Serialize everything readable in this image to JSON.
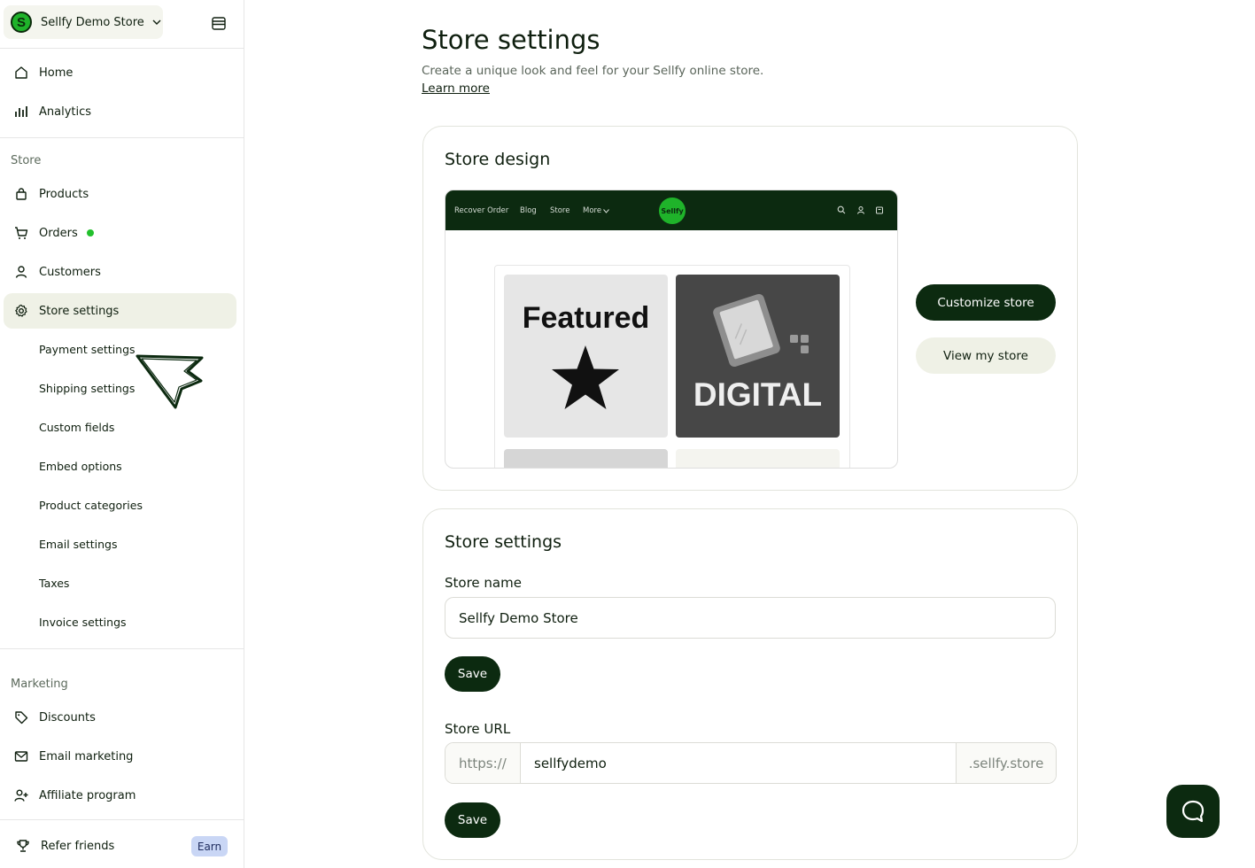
{
  "sidebar": {
    "store_switch": {
      "initial": "S",
      "name": "Sellfy Demo Store"
    },
    "top_nav": [
      {
        "label": "Home",
        "icon": "home-icon"
      },
      {
        "label": "Analytics",
        "icon": "bar-chart-icon"
      }
    ],
    "store_section": {
      "title": "Store",
      "items": [
        {
          "label": "Products",
          "icon": "bag-icon"
        },
        {
          "label": "Orders",
          "icon": "cart-icon"
        },
        {
          "label": "Customers",
          "icon": "user-icon"
        },
        {
          "label": "Store settings",
          "icon": "gear-icon"
        }
      ],
      "sub_items": [
        "Payment settings",
        "Shipping settings",
        "Custom fields",
        "Embed options",
        "Product categories",
        "Email settings",
        "Taxes",
        "Invoice settings"
      ]
    },
    "marketing_section": {
      "title": "Marketing",
      "items": [
        {
          "label": "Discounts",
          "icon": "tag-icon"
        },
        {
          "label": "Email marketing",
          "icon": "mail-icon"
        },
        {
          "label": "Affiliate program",
          "icon": "user-plus-icon"
        }
      ]
    },
    "refer": {
      "label": "Refer friends",
      "badge": "Earn",
      "icon": "trophy-icon"
    }
  },
  "header": {
    "title": "Store settings",
    "subtitle": "Create a unique look and feel for your Sellfy online store.",
    "learn_more": "Learn more"
  },
  "store_design": {
    "title": "Store design",
    "preview": {
      "nav_links": [
        "Recover Order",
        "Blog",
        "Store",
        "More"
      ],
      "logo_text": "Sellfy",
      "tile_featured": "Featured",
      "tile_digital": "DIGITAL"
    },
    "customize_label": "Customize store",
    "view_label": "View my store"
  },
  "store_settings": {
    "title": "Store settings",
    "store_name_label": "Store name",
    "store_name_value": "Sellfy Demo Store",
    "save_label": "Save",
    "store_url_label": "Store URL",
    "url_prefix": "https://",
    "url_value": "sellfydemo",
    "url_suffix": ".sellfy.store",
    "save_label_2": "Save"
  },
  "colors": {
    "brand_dark": "#0c2a10",
    "brand_green": "#1fb32a",
    "active_bg": "#eff1e6",
    "badge_bg": "#c9d6f5"
  }
}
